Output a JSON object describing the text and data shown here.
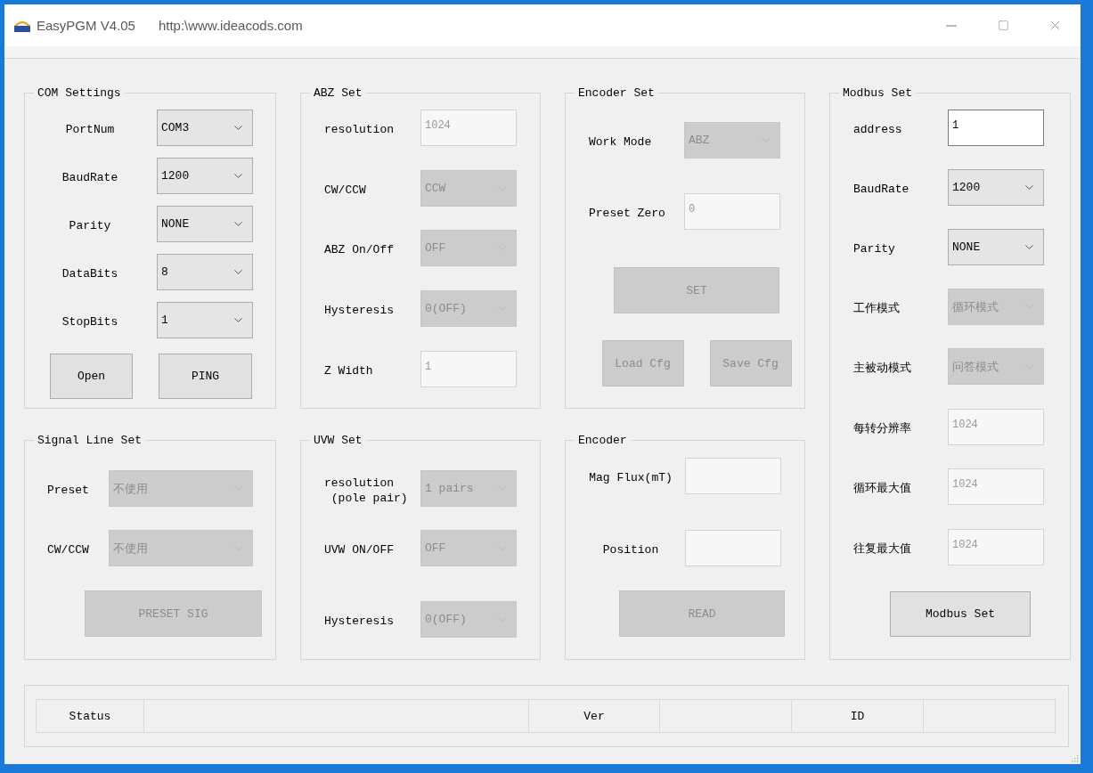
{
  "window": {
    "title": "EasyPGM V4.05",
    "url": "http:\\www.ideacods.com"
  },
  "columns": [
    {
      "groups": [
        {
          "title": "COM Settings",
          "rows": [
            {
              "label": "PortNum",
              "control": {
                "kind": "combo",
                "value": "COM3",
                "disabled": false
              }
            },
            {
              "label": "BaudRate",
              "control": {
                "kind": "combo",
                "value": "1200",
                "disabled": false
              }
            },
            {
              "label": "Parity",
              "control": {
                "kind": "combo",
                "value": "NONE",
                "disabled": false
              }
            },
            {
              "label": "DataBits",
              "control": {
                "kind": "combo",
                "value": "8",
                "disabled": false
              }
            },
            {
              "label": "StopBits",
              "control": {
                "kind": "combo",
                "value": "1",
                "disabled": false
              }
            }
          ],
          "buttons": [
            {
              "label": "Open",
              "disabled": false
            },
            {
              "label": "PING",
              "disabled": false
            }
          ]
        },
        {
          "title": "Signal Line Set",
          "rows": [
            {
              "label": "Preset",
              "control": {
                "kind": "combo",
                "value": "不使用",
                "disabled": true
              }
            },
            {
              "label": "CW/CCW",
              "control": {
                "kind": "combo",
                "value": "不使用",
                "disabled": true
              }
            }
          ],
          "buttons": [
            {
              "label": "PRESET SIG",
              "disabled": true
            }
          ]
        }
      ]
    },
    {
      "groups": [
        {
          "title": "ABZ Set",
          "rows": [
            {
              "label": "resolution",
              "control": {
                "kind": "text",
                "value": "1024",
                "disabled": true
              }
            },
            {
              "label": "CW/CCW",
              "control": {
                "kind": "combo",
                "value": "CCW",
                "disabled": true
              }
            },
            {
              "label": "ABZ On/Off",
              "control": {
                "kind": "combo",
                "value": "OFF",
                "disabled": true
              }
            },
            {
              "label": "Hysteresis",
              "control": {
                "kind": "combo",
                "value": "0(OFF)",
                "disabled": true
              }
            },
            {
              "label": "Z Width",
              "control": {
                "kind": "text",
                "value": "1",
                "disabled": true
              }
            }
          ]
        },
        {
          "title": "UVW Set",
          "rows": [
            {
              "label": "resolution\n (pole pair)",
              "control": {
                "kind": "combo",
                "value": "1 pairs",
                "disabled": true
              }
            },
            {
              "label": "UVW ON/OFF",
              "control": {
                "kind": "combo",
                "value": "OFF",
                "disabled": true
              }
            },
            {
              "label": "Hysteresis",
              "control": {
                "kind": "combo",
                "value": "0(OFF)",
                "disabled": true
              }
            }
          ]
        }
      ]
    },
    {
      "groups": [
        {
          "title": "Encoder Set",
          "rows": [
            {
              "label": "Work Mode",
              "control": {
                "kind": "combo",
                "value": "ABZ",
                "disabled": true
              }
            },
            {
              "label": "Preset Zero",
              "control": {
                "kind": "text",
                "value": "0",
                "disabled": true
              }
            }
          ],
          "buttons": [
            {
              "label": "SET",
              "disabled": true
            },
            {
              "label": "Load Cfg",
              "disabled": true
            },
            {
              "label": "Save Cfg",
              "disabled": true
            }
          ]
        },
        {
          "title": "Encoder",
          "rows": [
            {
              "label": "Mag Flux(mT)",
              "control": {
                "kind": "text",
                "disabled": true
              }
            },
            {
              "label": "Position",
              "control": {
                "kind": "text",
                "disabled": true
              }
            }
          ],
          "buttons": [
            {
              "label": "READ",
              "disabled": true
            }
          ]
        }
      ]
    },
    {
      "groups": [
        {
          "title": "Modbus Set",
          "rows": [
            {
              "label": "address",
              "control": {
                "kind": "text",
                "value": "1",
                "disabled": false
              }
            },
            {
              "label": "BaudRate",
              "control": {
                "kind": "combo",
                "value": "1200",
                "disabled": false
              }
            },
            {
              "label": "Parity",
              "control": {
                "kind": "combo",
                "value": "NONE",
                "disabled": false
              }
            },
            {
              "label": "工作模式",
              "control": {
                "kind": "combo",
                "value": "循环模式",
                "disabled": true
              }
            },
            {
              "label": "主被动模式",
              "control": {
                "kind": "combo",
                "value": "问答模式",
                "disabled": true
              }
            },
            {
              "label": "每转分辨率",
              "control": {
                "kind": "text",
                "value": "1024",
                "disabled": true
              }
            },
            {
              "label": "循环最大值",
              "control": {
                "kind": "text",
                "value": "1024",
                "disabled": true
              }
            },
            {
              "label": "往复最大值",
              "control": {
                "kind": "text",
                "value": "1024",
                "disabled": true
              }
            }
          ],
          "buttons": [
            {
              "label": "Modbus Set",
              "disabled": false
            }
          ]
        }
      ]
    }
  ],
  "status_bar": {
    "fields": [
      {
        "label": "Status"
      },
      {
        "label": "Ver"
      },
      {
        "label": "ID"
      }
    ]
  }
}
